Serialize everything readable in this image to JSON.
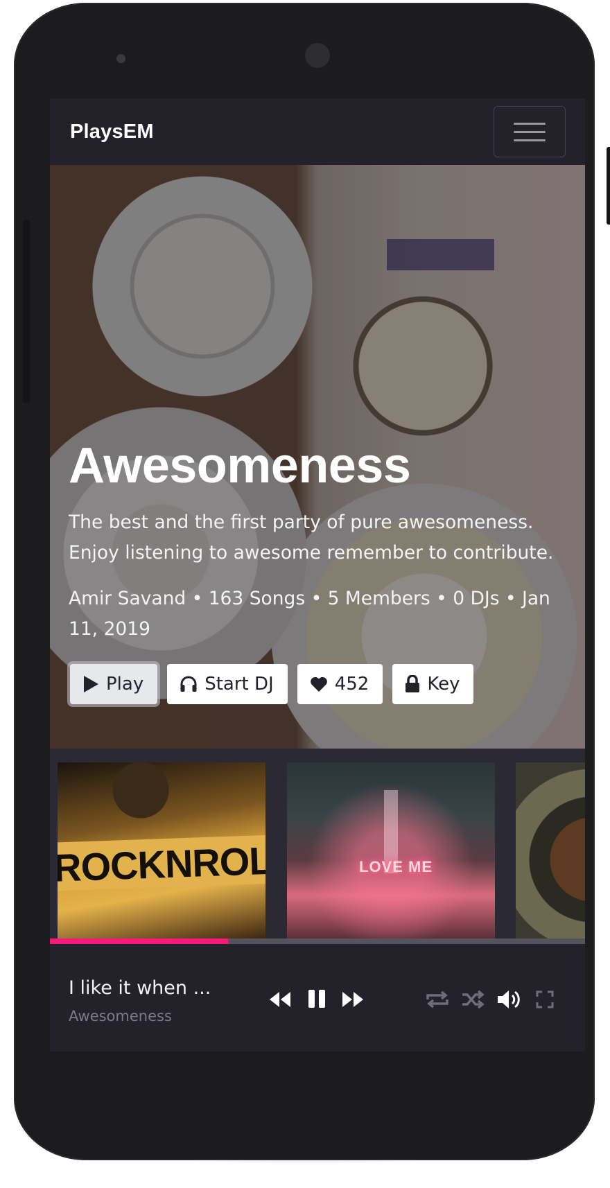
{
  "navbar": {
    "brand": "PlaysEM",
    "menu_icon": "hamburger-icon"
  },
  "hero": {
    "title": "Awesomeness",
    "description": "The best and the first party of pure awesomeness. Enjoy listening to awesome remember to contribute.",
    "meta": "Amir Savand • 163 Songs • 5 Members • 0 DJs • Jan 11, 2019",
    "background_image": "coffee-and-donuts-photo",
    "buttons": {
      "play": {
        "label": "Play",
        "icon": "play-icon"
      },
      "start_dj": {
        "label": "Start DJ",
        "icon": "headphones-icon"
      },
      "likes": {
        "label": "452",
        "icon": "heart-icon"
      },
      "key": {
        "label": "Key",
        "icon": "lock-icon"
      }
    }
  },
  "cards": [
    {
      "image": "rock-n-roll-poster",
      "text": "ROCKNROLL"
    },
    {
      "image": "neon-love-me-hallway",
      "text": "LOVE ME"
    },
    {
      "image": "portrait-photo"
    }
  ],
  "player": {
    "track_title": "I like it when ...",
    "track_subtitle": "Awesomeness",
    "progress": 0.333,
    "controls": [
      "rewind-icon",
      "pause-icon",
      "fast-forward-icon",
      "repeat-icon",
      "shuffle-icon",
      "volume-icon",
      "fullscreen-icon"
    ]
  },
  "colors": {
    "accent": "#f41b7c",
    "navbar_bg": "#23222b",
    "screen_bg": "#2b2a34",
    "phone_body": "#1c1c1e"
  }
}
